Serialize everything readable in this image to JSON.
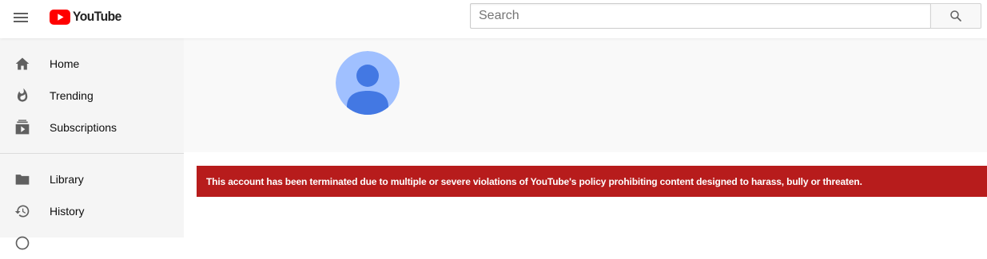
{
  "brand": {
    "name": "YouTube",
    "red": "#FF0000",
    "alert_red": "#B71C1C"
  },
  "masthead": {
    "menu_icon": "hamburger-menu-icon",
    "search": {
      "placeholder": "Search",
      "value": "",
      "icon": "search-icon"
    }
  },
  "sidebar": {
    "primary": [
      {
        "label": "Home",
        "icon": "home-icon"
      },
      {
        "label": "Trending",
        "icon": "flame-icon"
      },
      {
        "label": "Subscriptions",
        "icon": "subscriptions-icon"
      }
    ],
    "secondary": [
      {
        "label": "Library",
        "icon": "folder-icon"
      },
      {
        "label": "History",
        "icon": "history-icon"
      }
    ]
  },
  "channel": {
    "avatar_icon": "default-avatar-icon"
  },
  "alert": {
    "message": "This account has been terminated due to multiple or severe violations of YouTube's policy prohibiting content designed to harass, bully or threaten."
  }
}
